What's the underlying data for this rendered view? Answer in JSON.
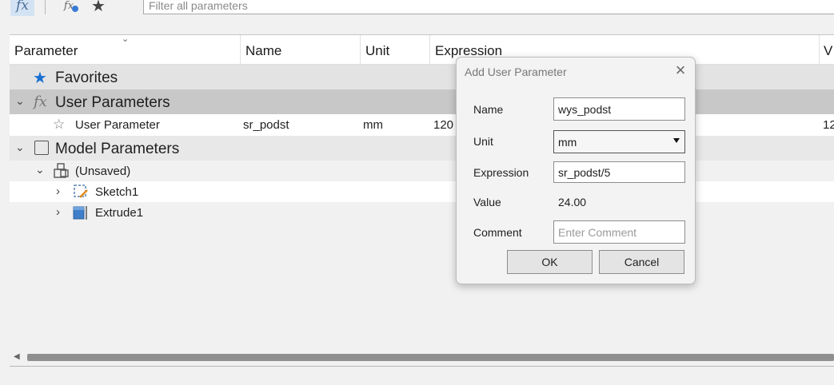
{
  "toolbar": {
    "fx_icon": "fx",
    "fx_user_icon": "fx",
    "favorites_icon": "★",
    "filter_placeholder": "Filter all parameters"
  },
  "table": {
    "columns": [
      "Parameter",
      "Name",
      "Unit",
      "Expression",
      "V"
    ],
    "groups": {
      "favorites": {
        "label": "Favorites",
        "icon": "★"
      },
      "user_parameters": {
        "label": "User Parameters",
        "icon": "fx",
        "chevron": "⌄"
      },
      "model_parameters": {
        "label": "Model Parameters",
        "chevron": "⌄"
      }
    },
    "user_param_row": {
      "parameter": "User Parameter",
      "name": "sr_podst",
      "unit": "mm",
      "expression": "120",
      "value_partial": "12"
    },
    "model_tree": {
      "unsaved": "(Unsaved)",
      "sketch": "Sketch1",
      "extrude": "Extrude1"
    }
  },
  "dialog": {
    "title": "Add User Parameter",
    "close_glyph": "×",
    "labels": {
      "name": "Name",
      "unit": "Unit",
      "expression": "Expression",
      "value": "Value",
      "comment": "Comment"
    },
    "name_value": "wys_podst",
    "unit_value": "mm",
    "expression_value": "sr_podst/5",
    "value_text": "24.00",
    "comment_placeholder": "Enter Comment",
    "ok_label": "OK",
    "cancel_label": "Cancel"
  },
  "colors": {
    "accent_blue": "#1a6fd1",
    "group_selected_bg": "#c8c8c8",
    "scroll_thumb": "#8f8f8f"
  }
}
